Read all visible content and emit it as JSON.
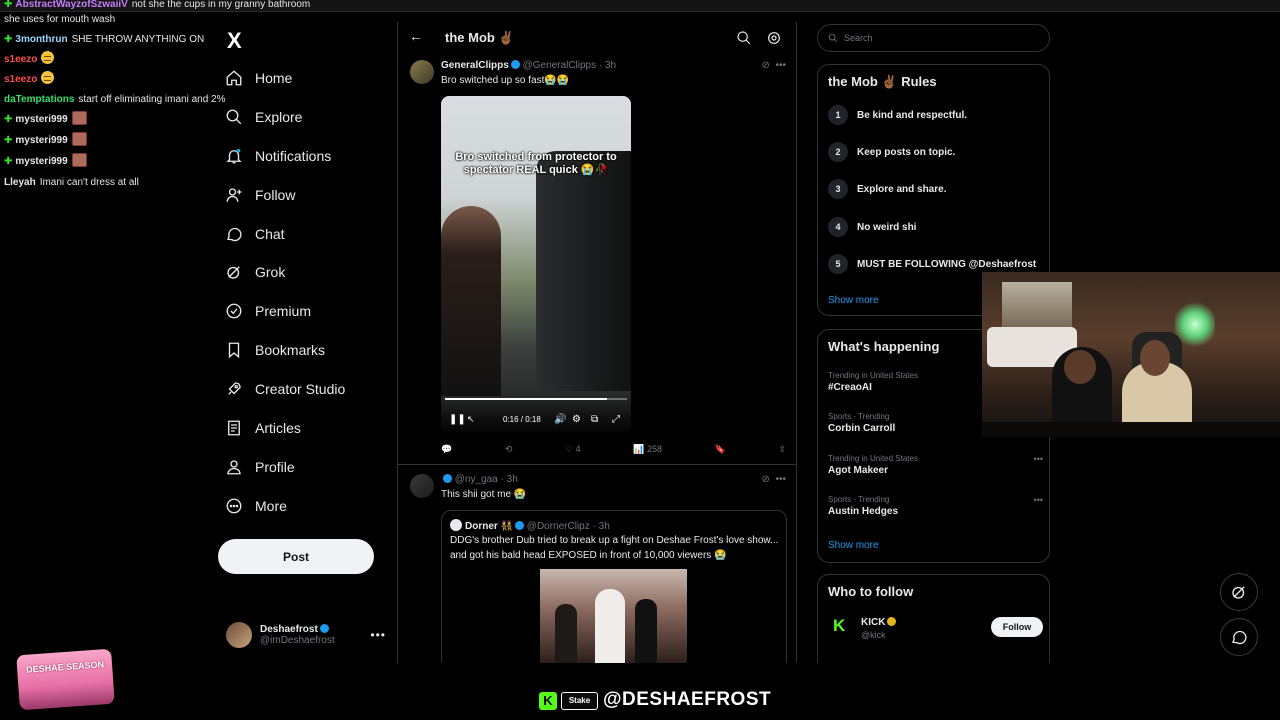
{
  "chat": {
    "lines": [
      {
        "user": "AbstractWayzofSzwaiiV",
        "message": "not she the cups in my granny bathroom",
        "user_color": "#c77dff",
        "badge": true
      },
      {
        "user": "",
        "message": "she uses for mouth wash",
        "user_color": "#e6e6e6",
        "badge": false
      },
      {
        "user": "3monthrun",
        "message": "SHE THROW ANYTHING ON",
        "user_color": "#9ad3ff",
        "badge": true
      },
      {
        "user": "s1eezo",
        "message": "",
        "user_color": "#ff4d4d",
        "badge": false,
        "emoji": "grimace"
      },
      {
        "user": "s1eezo",
        "message": "",
        "user_color": "#ff4d4d",
        "badge": false,
        "emoji": "grimace"
      },
      {
        "user": "daTemptations",
        "message": "start off eliminating imani and 2%",
        "user_color": "#39e06b",
        "badge": false
      },
      {
        "user": "mysteri999",
        "message": "",
        "user_color": "#f0f0f0",
        "badge": true,
        "emoji": "emote"
      },
      {
        "user": "mysteri999",
        "message": "",
        "user_color": "#f0f0f0",
        "badge": true,
        "emoji": "emote"
      },
      {
        "user": "mysteri999",
        "message": "",
        "user_color": "#f0f0f0",
        "badge": true,
        "emoji": "emote"
      },
      {
        "user": "Lleyah",
        "message": "Imani can't dress at all",
        "user_color": "#f0f0f0",
        "badge": false
      }
    ]
  },
  "sidebar": {
    "logo": "X",
    "items": [
      {
        "label": "Home",
        "icon": "home-icon"
      },
      {
        "label": "Explore",
        "icon": "search-icon"
      },
      {
        "label": "Notifications",
        "icon": "bell-icon"
      },
      {
        "label": "Follow",
        "icon": "person-add-icon"
      },
      {
        "label": "Chat",
        "icon": "chat-icon"
      },
      {
        "label": "Grok",
        "icon": "grok-icon"
      },
      {
        "label": "Premium",
        "icon": "premium-icon"
      },
      {
        "label": "Bookmarks",
        "icon": "bookmark-icon"
      },
      {
        "label": "Creator Studio",
        "icon": "rocket-icon"
      },
      {
        "label": "Articles",
        "icon": "article-icon"
      },
      {
        "label": "Profile",
        "icon": "person-icon"
      },
      {
        "label": "More",
        "icon": "more-circle-icon"
      }
    ],
    "post_label": "Post",
    "account": {
      "name": "Deshaefrost",
      "handle": "@imDeshaefrost"
    }
  },
  "main": {
    "title": "the Mob ✌🏾",
    "tweet1": {
      "name": "GeneralClipps",
      "handle": "@GeneralClipps",
      "time": "· 3h",
      "text": "Bro switched up so fast😭😭",
      "video_caption": "Bro switched from protector to spectator REAL quick 😭🥀",
      "video_time": "0:16 / 0:18",
      "progress": 0.89,
      "reposts": "",
      "likes": "4",
      "views": "258"
    },
    "tweet2": {
      "name": "",
      "handle": "@ny_gaa",
      "time": "· 3h",
      "text": "This shii got me 😭",
      "quote": {
        "name": "Dorner 👯",
        "handle": "@DornerClipz",
        "time": "· 3h",
        "text": "DDG's brother Dub tried to break up a fight on Deshae Frost's love show... and got his bald head EXPOSED in front of 10,000 viewers 😭"
      }
    }
  },
  "right": {
    "search_placeholder": "Search",
    "rules": {
      "title": "the Mob ✌🏾 Rules",
      "items": [
        "Be kind and respectful.",
        "Keep posts on topic.",
        "Explore and share.",
        "No weird shi",
        "MUST BE FOLLOWING @Deshaefrost"
      ],
      "show_more": "Show more"
    },
    "happening": {
      "title": "What's happening",
      "trends": [
        {
          "context": "Trending in United States",
          "title": "#CreaoAI"
        },
        {
          "context": "Sports · Trending",
          "title": "Corbin Carroll"
        },
        {
          "context": "Trending in United States",
          "title": "Agot Makeer"
        },
        {
          "context": "Sports · Trending",
          "title": "Austin Hedges"
        }
      ],
      "show_more": "Show more"
    },
    "who_to_follow": {
      "title": "Who to follow",
      "name": "KICK",
      "handle": "@kick",
      "follow_label": "Follow"
    }
  },
  "stream": {
    "logo_text": "DESHAE SEASON",
    "kick_glyph": "K",
    "stake_label": "Stake",
    "handle": "@DESHAEFROST"
  },
  "colors": {
    "accent": "#1d9bf0",
    "kick_green": "#53fc18",
    "background": "#000000"
  }
}
